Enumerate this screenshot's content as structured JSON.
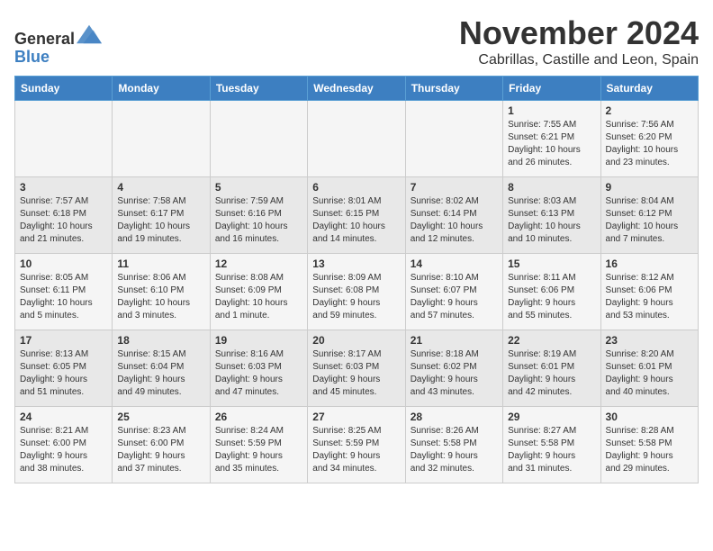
{
  "logo": {
    "line1": "General",
    "line2": "Blue"
  },
  "title": "November 2024",
  "location": "Cabrillas, Castille and Leon, Spain",
  "weekdays": [
    "Sunday",
    "Monday",
    "Tuesday",
    "Wednesday",
    "Thursday",
    "Friday",
    "Saturday"
  ],
  "weeks": [
    [
      {
        "day": "",
        "info": ""
      },
      {
        "day": "",
        "info": ""
      },
      {
        "day": "",
        "info": ""
      },
      {
        "day": "",
        "info": ""
      },
      {
        "day": "",
        "info": ""
      },
      {
        "day": "1",
        "info": "Sunrise: 7:55 AM\nSunset: 6:21 PM\nDaylight: 10 hours\nand 26 minutes."
      },
      {
        "day": "2",
        "info": "Sunrise: 7:56 AM\nSunset: 6:20 PM\nDaylight: 10 hours\nand 23 minutes."
      }
    ],
    [
      {
        "day": "3",
        "info": "Sunrise: 7:57 AM\nSunset: 6:18 PM\nDaylight: 10 hours\nand 21 minutes."
      },
      {
        "day": "4",
        "info": "Sunrise: 7:58 AM\nSunset: 6:17 PM\nDaylight: 10 hours\nand 19 minutes."
      },
      {
        "day": "5",
        "info": "Sunrise: 7:59 AM\nSunset: 6:16 PM\nDaylight: 10 hours\nand 16 minutes."
      },
      {
        "day": "6",
        "info": "Sunrise: 8:01 AM\nSunset: 6:15 PM\nDaylight: 10 hours\nand 14 minutes."
      },
      {
        "day": "7",
        "info": "Sunrise: 8:02 AM\nSunset: 6:14 PM\nDaylight: 10 hours\nand 12 minutes."
      },
      {
        "day": "8",
        "info": "Sunrise: 8:03 AM\nSunset: 6:13 PM\nDaylight: 10 hours\nand 10 minutes."
      },
      {
        "day": "9",
        "info": "Sunrise: 8:04 AM\nSunset: 6:12 PM\nDaylight: 10 hours\nand 7 minutes."
      }
    ],
    [
      {
        "day": "10",
        "info": "Sunrise: 8:05 AM\nSunset: 6:11 PM\nDaylight: 10 hours\nand 5 minutes."
      },
      {
        "day": "11",
        "info": "Sunrise: 8:06 AM\nSunset: 6:10 PM\nDaylight: 10 hours\nand 3 minutes."
      },
      {
        "day": "12",
        "info": "Sunrise: 8:08 AM\nSunset: 6:09 PM\nDaylight: 10 hours\nand 1 minute."
      },
      {
        "day": "13",
        "info": "Sunrise: 8:09 AM\nSunset: 6:08 PM\nDaylight: 9 hours\nand 59 minutes."
      },
      {
        "day": "14",
        "info": "Sunrise: 8:10 AM\nSunset: 6:07 PM\nDaylight: 9 hours\nand 57 minutes."
      },
      {
        "day": "15",
        "info": "Sunrise: 8:11 AM\nSunset: 6:06 PM\nDaylight: 9 hours\nand 55 minutes."
      },
      {
        "day": "16",
        "info": "Sunrise: 8:12 AM\nSunset: 6:06 PM\nDaylight: 9 hours\nand 53 minutes."
      }
    ],
    [
      {
        "day": "17",
        "info": "Sunrise: 8:13 AM\nSunset: 6:05 PM\nDaylight: 9 hours\nand 51 minutes."
      },
      {
        "day": "18",
        "info": "Sunrise: 8:15 AM\nSunset: 6:04 PM\nDaylight: 9 hours\nand 49 minutes."
      },
      {
        "day": "19",
        "info": "Sunrise: 8:16 AM\nSunset: 6:03 PM\nDaylight: 9 hours\nand 47 minutes."
      },
      {
        "day": "20",
        "info": "Sunrise: 8:17 AM\nSunset: 6:03 PM\nDaylight: 9 hours\nand 45 minutes."
      },
      {
        "day": "21",
        "info": "Sunrise: 8:18 AM\nSunset: 6:02 PM\nDaylight: 9 hours\nand 43 minutes."
      },
      {
        "day": "22",
        "info": "Sunrise: 8:19 AM\nSunset: 6:01 PM\nDaylight: 9 hours\nand 42 minutes."
      },
      {
        "day": "23",
        "info": "Sunrise: 8:20 AM\nSunset: 6:01 PM\nDaylight: 9 hours\nand 40 minutes."
      }
    ],
    [
      {
        "day": "24",
        "info": "Sunrise: 8:21 AM\nSunset: 6:00 PM\nDaylight: 9 hours\nand 38 minutes."
      },
      {
        "day": "25",
        "info": "Sunrise: 8:23 AM\nSunset: 6:00 PM\nDaylight: 9 hours\nand 37 minutes."
      },
      {
        "day": "26",
        "info": "Sunrise: 8:24 AM\nSunset: 5:59 PM\nDaylight: 9 hours\nand 35 minutes."
      },
      {
        "day": "27",
        "info": "Sunrise: 8:25 AM\nSunset: 5:59 PM\nDaylight: 9 hours\nand 34 minutes."
      },
      {
        "day": "28",
        "info": "Sunrise: 8:26 AM\nSunset: 5:58 PM\nDaylight: 9 hours\nand 32 minutes."
      },
      {
        "day": "29",
        "info": "Sunrise: 8:27 AM\nSunset: 5:58 PM\nDaylight: 9 hours\nand 31 minutes."
      },
      {
        "day": "30",
        "info": "Sunrise: 8:28 AM\nSunset: 5:58 PM\nDaylight: 9 hours\nand 29 minutes."
      }
    ]
  ]
}
